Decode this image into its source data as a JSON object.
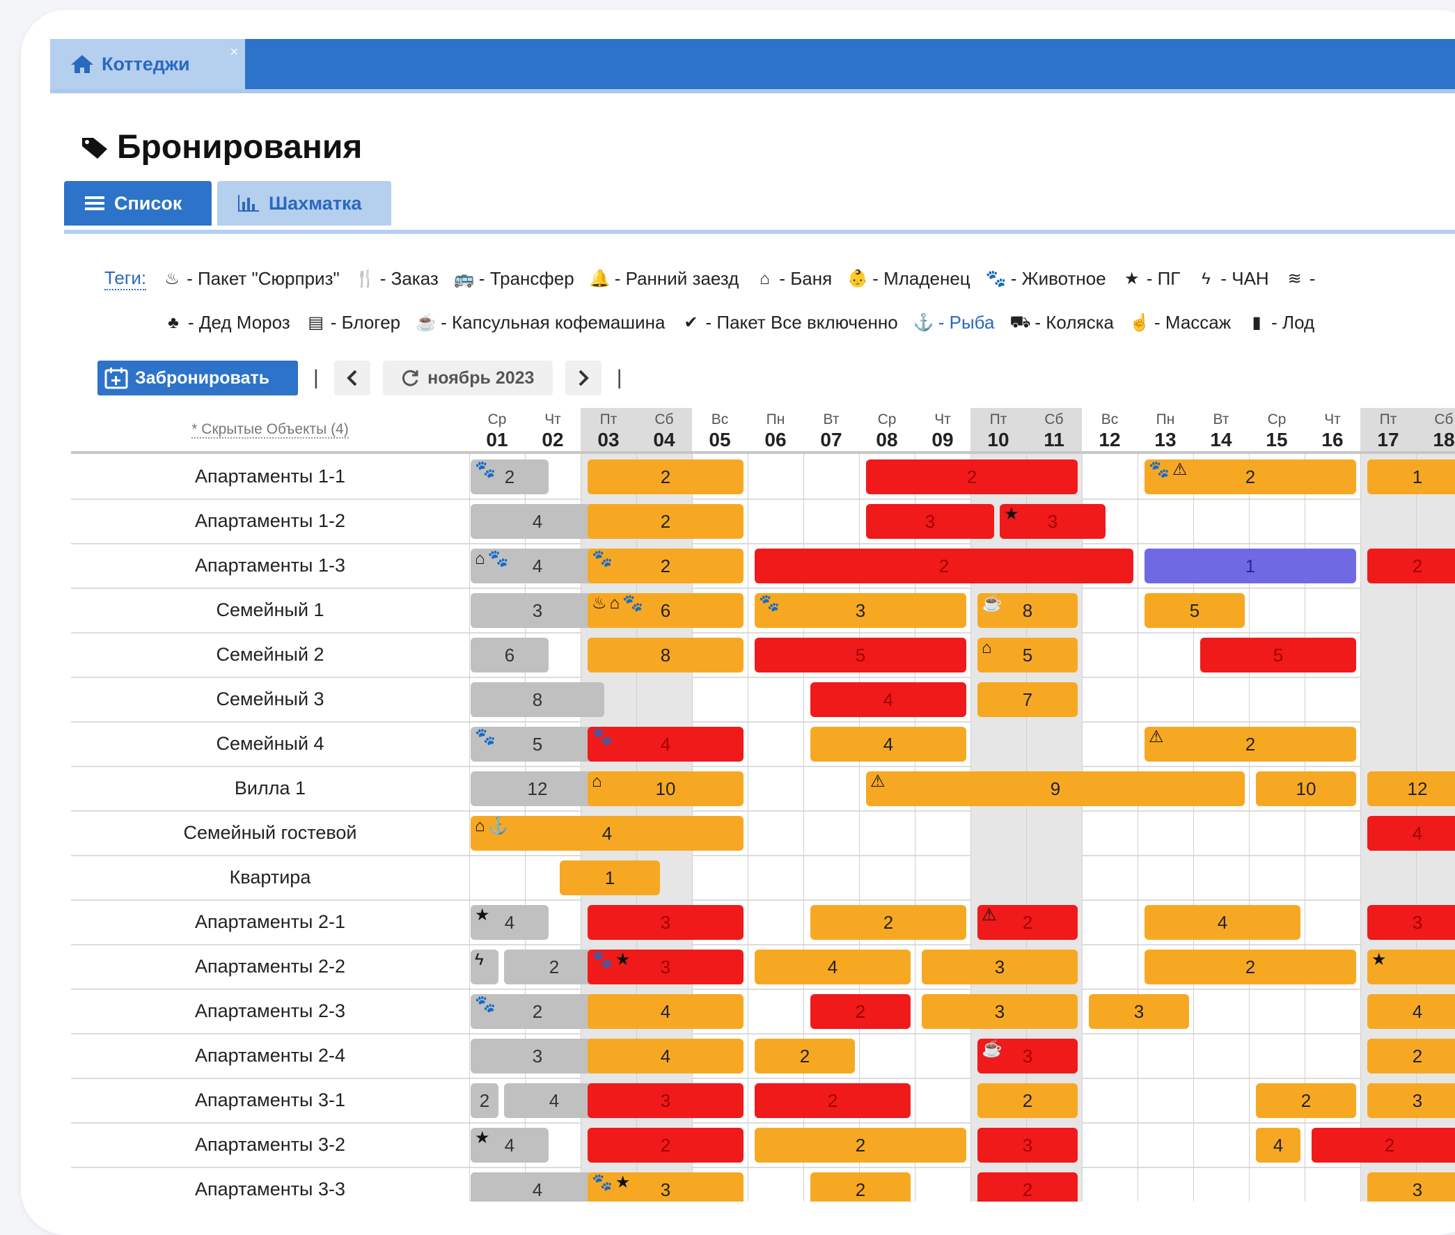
{
  "tab": {
    "label": "Коттеджи",
    "close": "×"
  },
  "page_title": "Бронирования",
  "view_tabs": {
    "list": "Список",
    "chess": "Шахматка"
  },
  "tags": {
    "label": "Теги:",
    "line1": [
      {
        "glyph": "♨",
        "icon": "cake-icon",
        "text": "- Пакет \"Сюрприз\""
      },
      {
        "glyph": "🍴",
        "icon": "cutlery-icon",
        "text": "- Заказ"
      },
      {
        "glyph": "🚌",
        "icon": "bus-icon",
        "text": "- Трансфер"
      },
      {
        "glyph": "🔔",
        "icon": "bell-icon",
        "text": "- Ранний заезд"
      },
      {
        "glyph": "⌂",
        "icon": "home-icon",
        "text": "- Баня"
      },
      {
        "glyph": "👶",
        "icon": "child-icon",
        "text": "- Младенец"
      },
      {
        "glyph": "🐾",
        "icon": "paw-icon",
        "text": "- Животное"
      },
      {
        "glyph": "★",
        "icon": "star-icon",
        "text": "- ПГ"
      },
      {
        "glyph": "ϟ",
        "icon": "bolt-icon",
        "text": "- ЧАН"
      },
      {
        "glyph": "≋",
        "icon": "wifi-icon",
        "text": "-"
      }
    ],
    "line2": [
      {
        "glyph": "♣",
        "icon": "tree-icon",
        "text": "- Дед Мороз"
      },
      {
        "glyph": "▤",
        "icon": "blogger-icon",
        "text": "- Блогер"
      },
      {
        "glyph": "☕",
        "icon": "coffee-icon",
        "text": "- Капсульная кофемашина"
      },
      {
        "glyph": "✔",
        "icon": "check-icon",
        "text": "- Пакет Все включенно"
      },
      {
        "glyph": "⚓",
        "icon": "anchor-icon",
        "text": "- Рыба",
        "blue": true
      },
      {
        "glyph": "⛟",
        "icon": "stroller-icon",
        "text": "- Коляска"
      },
      {
        "glyph": "☝",
        "icon": "hand-icon",
        "text": "- Массаж"
      },
      {
        "glyph": "▮",
        "icon": "bookmark-icon",
        "text": "- Лод"
      }
    ]
  },
  "toolbar": {
    "book": "Забронировать",
    "sep": "|",
    "prev": "<",
    "month": "ноябрь 2023",
    "next": ">"
  },
  "hidden_objects": "* Скрытые Объекты (4)",
  "days": [
    {
      "dow": "Ср",
      "d": "01"
    },
    {
      "dow": "Чт",
      "d": "02"
    },
    {
      "dow": "Пт",
      "d": "03",
      "we": true
    },
    {
      "dow": "Сб",
      "d": "04",
      "we": true
    },
    {
      "dow": "Вс",
      "d": "05"
    },
    {
      "dow": "Пн",
      "d": "06"
    },
    {
      "dow": "Вт",
      "d": "07"
    },
    {
      "dow": "Ср",
      "d": "08"
    },
    {
      "dow": "Чт",
      "d": "09"
    },
    {
      "dow": "Пт",
      "d": "10",
      "we": true
    },
    {
      "dow": "Сб",
      "d": "11",
      "we": true
    },
    {
      "dow": "Вс",
      "d": "12"
    },
    {
      "dow": "Пн",
      "d": "13"
    },
    {
      "dow": "Вт",
      "d": "14"
    },
    {
      "dow": "Ср",
      "d": "15"
    },
    {
      "dow": "Чт",
      "d": "16"
    },
    {
      "dow": "Пт",
      "d": "17",
      "we": true
    },
    {
      "dow": "Сб",
      "d": "18",
      "we": true
    }
  ],
  "rows": [
    {
      "name": "Апартаменты 1-1",
      "bars": [
        {
          "s": 1,
          "e": 2.4,
          "c": "gray",
          "n": "2",
          "icons": "🐾"
        },
        {
          "s": 3.1,
          "e": 5.9,
          "c": "orange",
          "n": "2"
        },
        {
          "s": 8.1,
          "e": 11.9,
          "c": "red",
          "n": "2"
        },
        {
          "s": 13.1,
          "e": 16.9,
          "c": "orange",
          "n": "2",
          "icons": "🐾⚠"
        },
        {
          "s": 17.1,
          "e": 18.9,
          "c": "orange",
          "n": "1"
        }
      ]
    },
    {
      "name": "Апартаменты 1-2",
      "bars": [
        {
          "s": 1,
          "e": 3.4,
          "c": "gray",
          "n": "4"
        },
        {
          "s": 3.1,
          "e": 5.9,
          "c": "orange",
          "n": "2"
        },
        {
          "s": 8.1,
          "e": 10.4,
          "c": "red",
          "n": "3"
        },
        {
          "s": 10.5,
          "e": 12.4,
          "c": "red",
          "n": "3",
          "icons": "★"
        }
      ]
    },
    {
      "name": "Апартаменты 1-3",
      "bars": [
        {
          "s": 1,
          "e": 3.4,
          "c": "gray",
          "n": "4",
          "icons": "⌂🐾"
        },
        {
          "s": 3.1,
          "e": 5.9,
          "c": "orange",
          "n": "2",
          "icons": "🐾"
        },
        {
          "s": 6.1,
          "e": 12.9,
          "c": "red",
          "n": "2"
        },
        {
          "s": 13.1,
          "e": 16.9,
          "c": "purple",
          "n": "1"
        },
        {
          "s": 17.1,
          "e": 18.9,
          "c": "red",
          "n": "2"
        }
      ]
    },
    {
      "name": "Семейный 1",
      "bars": [
        {
          "s": 1,
          "e": 3.4,
          "c": "gray",
          "n": "3"
        },
        {
          "s": 3.1,
          "e": 5.9,
          "c": "orange",
          "n": "6",
          "icons": "♨⌂🐾"
        },
        {
          "s": 6.1,
          "e": 9.9,
          "c": "orange",
          "n": "3",
          "icons": "🐾"
        },
        {
          "s": 10.1,
          "e": 11.9,
          "c": "orange",
          "n": "8",
          "icons": "☕"
        },
        {
          "s": 13.1,
          "e": 14.9,
          "c": "orange",
          "n": "5"
        }
      ]
    },
    {
      "name": "Семейный 2",
      "bars": [
        {
          "s": 1,
          "e": 2.4,
          "c": "gray",
          "n": "6"
        },
        {
          "s": 3.1,
          "e": 5.9,
          "c": "orange",
          "n": "8"
        },
        {
          "s": 6.1,
          "e": 9.9,
          "c": "red",
          "n": "5"
        },
        {
          "s": 10.1,
          "e": 11.9,
          "c": "orange",
          "n": "5",
          "icons": "⌂"
        },
        {
          "s": 14.1,
          "e": 16.9,
          "c": "red",
          "n": "5"
        }
      ]
    },
    {
      "name": "Семейный 3",
      "bars": [
        {
          "s": 1,
          "e": 3.4,
          "c": "gray",
          "n": "8"
        },
        {
          "s": 7.1,
          "e": 9.9,
          "c": "red",
          "n": "4"
        },
        {
          "s": 10.1,
          "e": 11.9,
          "c": "orange",
          "n": "7"
        }
      ]
    },
    {
      "name": "Семейный 4",
      "bars": [
        {
          "s": 1,
          "e": 3.4,
          "c": "gray",
          "n": "5",
          "icons": "🐾"
        },
        {
          "s": 3.1,
          "e": 5.9,
          "c": "red",
          "n": "4",
          "icons": "🐾"
        },
        {
          "s": 7.1,
          "e": 9.9,
          "c": "orange",
          "n": "4"
        },
        {
          "s": 13.1,
          "e": 16.9,
          "c": "orange",
          "n": "2",
          "icons": "⚠"
        }
      ]
    },
    {
      "name": "Вилла 1",
      "bars": [
        {
          "s": 1,
          "e": 3.4,
          "c": "gray",
          "n": "12"
        },
        {
          "s": 3.1,
          "e": 5.9,
          "c": "orange",
          "n": "10",
          "icons": "⌂"
        },
        {
          "s": 8.1,
          "e": 14.9,
          "c": "orange",
          "n": "9",
          "icons": "⚠"
        },
        {
          "s": 15.1,
          "e": 16.9,
          "c": "orange",
          "n": "10"
        },
        {
          "s": 17.1,
          "e": 18.9,
          "c": "orange",
          "n": "12"
        }
      ]
    },
    {
      "name": "Семейный гостевой",
      "bars": [
        {
          "s": 1,
          "e": 5.9,
          "c": "orange",
          "n": "4",
          "icons": "⌂⚓"
        },
        {
          "s": 17.1,
          "e": 18.9,
          "c": "red",
          "n": "4"
        }
      ]
    },
    {
      "name": "Квартира",
      "bars": [
        {
          "s": 2.6,
          "e": 4.4,
          "c": "orange",
          "n": "1"
        }
      ]
    },
    {
      "name": "Апартаменты 2-1",
      "bars": [
        {
          "s": 1,
          "e": 2.4,
          "c": "gray",
          "n": "4",
          "icons": "★"
        },
        {
          "s": 3.1,
          "e": 5.9,
          "c": "red",
          "n": "3"
        },
        {
          "s": 7.1,
          "e": 9.9,
          "c": "orange",
          "n": "2"
        },
        {
          "s": 10.1,
          "e": 11.9,
          "c": "red",
          "n": "2",
          "icons": "⚠"
        },
        {
          "s": 13.1,
          "e": 15.9,
          "c": "orange",
          "n": "4"
        },
        {
          "s": 17.1,
          "e": 18.9,
          "c": "red",
          "n": "3"
        }
      ]
    },
    {
      "name": "Апартаменты 2-2",
      "bars": [
        {
          "s": 1,
          "e": 1.5,
          "c": "gray",
          "n": "",
          "icons": "ϟ"
        },
        {
          "s": 1.6,
          "e": 3.4,
          "c": "gray",
          "n": "2"
        },
        {
          "s": 3.1,
          "e": 5.9,
          "c": "red",
          "n": "3",
          "icons": "🐾★"
        },
        {
          "s": 6.1,
          "e": 8.9,
          "c": "orange",
          "n": "4"
        },
        {
          "s": 9.1,
          "e": 11.9,
          "c": "orange",
          "n": "3"
        },
        {
          "s": 13.1,
          "e": 16.9,
          "c": "orange",
          "n": "2"
        },
        {
          "s": 17.1,
          "e": 18.9,
          "c": "orange",
          "n": "",
          "icons": "★"
        }
      ]
    },
    {
      "name": "Апартаменты 2-3",
      "bars": [
        {
          "s": 1,
          "e": 3.4,
          "c": "gray",
          "n": "2",
          "icons": "🐾"
        },
        {
          "s": 3.1,
          "e": 5.9,
          "c": "orange",
          "n": "4"
        },
        {
          "s": 7.1,
          "e": 8.9,
          "c": "red",
          "n": "2"
        },
        {
          "s": 9.1,
          "e": 11.9,
          "c": "orange",
          "n": "3"
        },
        {
          "s": 12.1,
          "e": 13.9,
          "c": "orange",
          "n": "3"
        },
        {
          "s": 17.1,
          "e": 18.9,
          "c": "orange",
          "n": "4"
        }
      ]
    },
    {
      "name": "Апартаменты 2-4",
      "bars": [
        {
          "s": 1,
          "e": 3.4,
          "c": "gray",
          "n": "3"
        },
        {
          "s": 3.1,
          "e": 5.9,
          "c": "orange",
          "n": "4"
        },
        {
          "s": 6.1,
          "e": 7.9,
          "c": "orange",
          "n": "2"
        },
        {
          "s": 10.1,
          "e": 11.9,
          "c": "red",
          "n": "3",
          "icons": "☕"
        },
        {
          "s": 17.1,
          "e": 18.9,
          "c": "orange",
          "n": "2"
        }
      ]
    },
    {
      "name": "Апартаменты 3-1",
      "bars": [
        {
          "s": 1,
          "e": 1.5,
          "c": "gray",
          "n": "2",
          "icons": ""
        },
        {
          "s": 1.6,
          "e": 3.4,
          "c": "gray",
          "n": "4"
        },
        {
          "s": 3.1,
          "e": 5.9,
          "c": "red",
          "n": "3"
        },
        {
          "s": 6.1,
          "e": 8.9,
          "c": "red",
          "n": "2"
        },
        {
          "s": 10.1,
          "e": 11.9,
          "c": "orange",
          "n": "2"
        },
        {
          "s": 15.1,
          "e": 16.9,
          "c": "orange",
          "n": "2"
        },
        {
          "s": 17.1,
          "e": 18.9,
          "c": "orange",
          "n": "3"
        }
      ]
    },
    {
      "name": "Апартаменты 3-2",
      "bars": [
        {
          "s": 1,
          "e": 2.4,
          "c": "gray",
          "n": "4",
          "icons": "★"
        },
        {
          "s": 3.1,
          "e": 5.9,
          "c": "red",
          "n": "2"
        },
        {
          "s": 6.1,
          "e": 9.9,
          "c": "orange",
          "n": "2"
        },
        {
          "s": 10.1,
          "e": 11.9,
          "c": "red",
          "n": "3"
        },
        {
          "s": 15.1,
          "e": 15.9,
          "c": "orange",
          "n": "4"
        },
        {
          "s": 16.1,
          "e": 18.9,
          "c": "red",
          "n": "2"
        }
      ]
    },
    {
      "name": "Апартаменты 3-3",
      "bars": [
        {
          "s": 1,
          "e": 3.4,
          "c": "gray",
          "n": "4"
        },
        {
          "s": 3.1,
          "e": 5.9,
          "c": "orange",
          "n": "3",
          "icons": "🐾★"
        },
        {
          "s": 7.1,
          "e": 8.9,
          "c": "orange",
          "n": "2"
        },
        {
          "s": 10.1,
          "e": 11.9,
          "c": "red",
          "n": "2"
        },
        {
          "s": 17.1,
          "e": 18.9,
          "c": "orange",
          "n": "3"
        }
      ]
    }
  ]
}
